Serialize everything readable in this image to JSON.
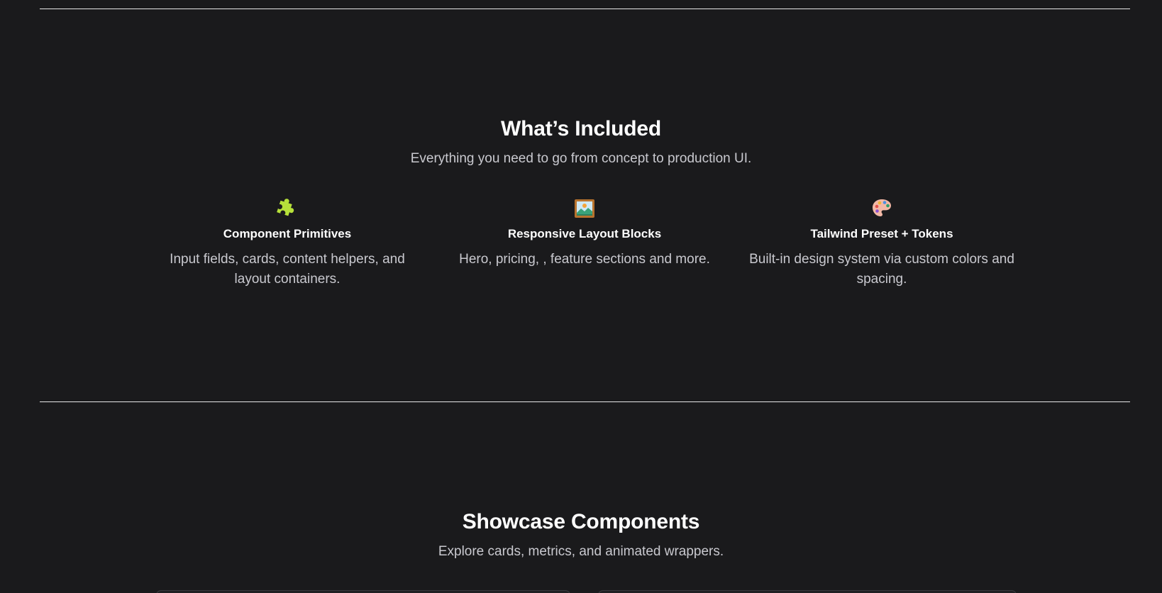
{
  "included": {
    "title": "What’s Included",
    "subtitle": "Everything you need to go from concept to production UI.",
    "features": [
      {
        "icon": "puzzle-icon",
        "title": "Component Primitives",
        "description": "Input fields, cards, content helpers, and layout containers."
      },
      {
        "icon": "framed-picture-icon",
        "title": "Responsive Layout Blocks",
        "description": "Hero, pricing, , feature sections and more."
      },
      {
        "icon": "palette-icon",
        "title": "Tailwind Preset + Tokens",
        "description": "Built-in design system via custom colors and spacing."
      }
    ]
  },
  "showcase": {
    "title": "Showcase Components",
    "subtitle": "Explore cards, metrics, and animated wrappers."
  },
  "colors": {
    "background": "#1a1a1c",
    "text_primary": "#ffffff",
    "text_secondary": "#c9c9cf",
    "divider": "#e8e8e8"
  }
}
